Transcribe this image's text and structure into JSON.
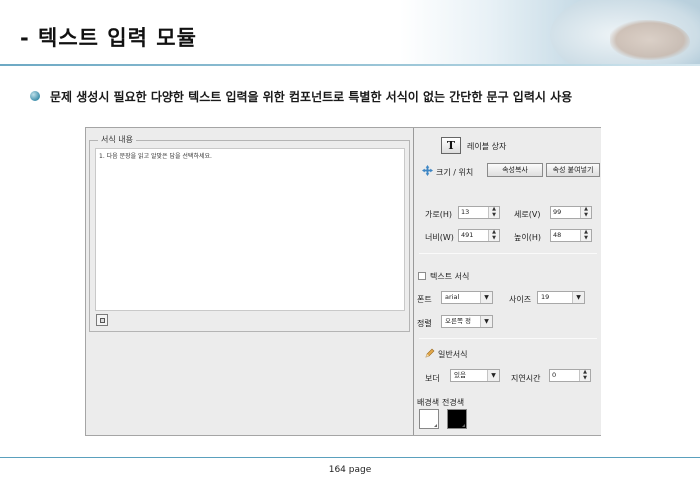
{
  "header": {
    "title": "- 텍스트 입력 모듈",
    "subtitle": "문제 생성시 필요한 다양한 텍스트 입력을 위한 컴포넌트로 특별한 서식이 없는 간단한 문구 입력시 사용"
  },
  "editor": {
    "group_label": "서식 내용",
    "content": "1. 다음 문장을 읽고 알맞은 답을 선택하세요."
  },
  "props": {
    "label_box": {
      "icon_text": "T",
      "label": "레이블 상자"
    },
    "size_pos": {
      "label": "크기 / 위치",
      "copy_button": "속성복사",
      "paste_button": "속성 붙여넣기",
      "fields": {
        "x": {
          "label": "가로(H)",
          "value": "13"
        },
        "y": {
          "label": "세로(V)",
          "value": "99"
        },
        "width": {
          "label": "너비(W)",
          "value": "491"
        },
        "height": {
          "label": "높이(H)",
          "value": "48"
        }
      }
    },
    "text_format": {
      "label": "텍스트 서식",
      "checked": false,
      "font_label": "폰트",
      "font_value": "arial",
      "size_label": "사이즈",
      "size_value": "19",
      "align_label": "정렬",
      "align_value": "오른쪽 정"
    },
    "general": {
      "label": "일반서식",
      "border_label": "보더",
      "border_value": "있음",
      "delay_label": "지연시간",
      "delay_value": "0",
      "bg_label": "배경색",
      "fg_label": "전경색",
      "bg_color": "#ffffff",
      "fg_color": "#000000"
    }
  },
  "footer": {
    "page": "164 page"
  },
  "colors": {
    "accent": "#5aa0bd",
    "bullet": "#3f8fab"
  }
}
